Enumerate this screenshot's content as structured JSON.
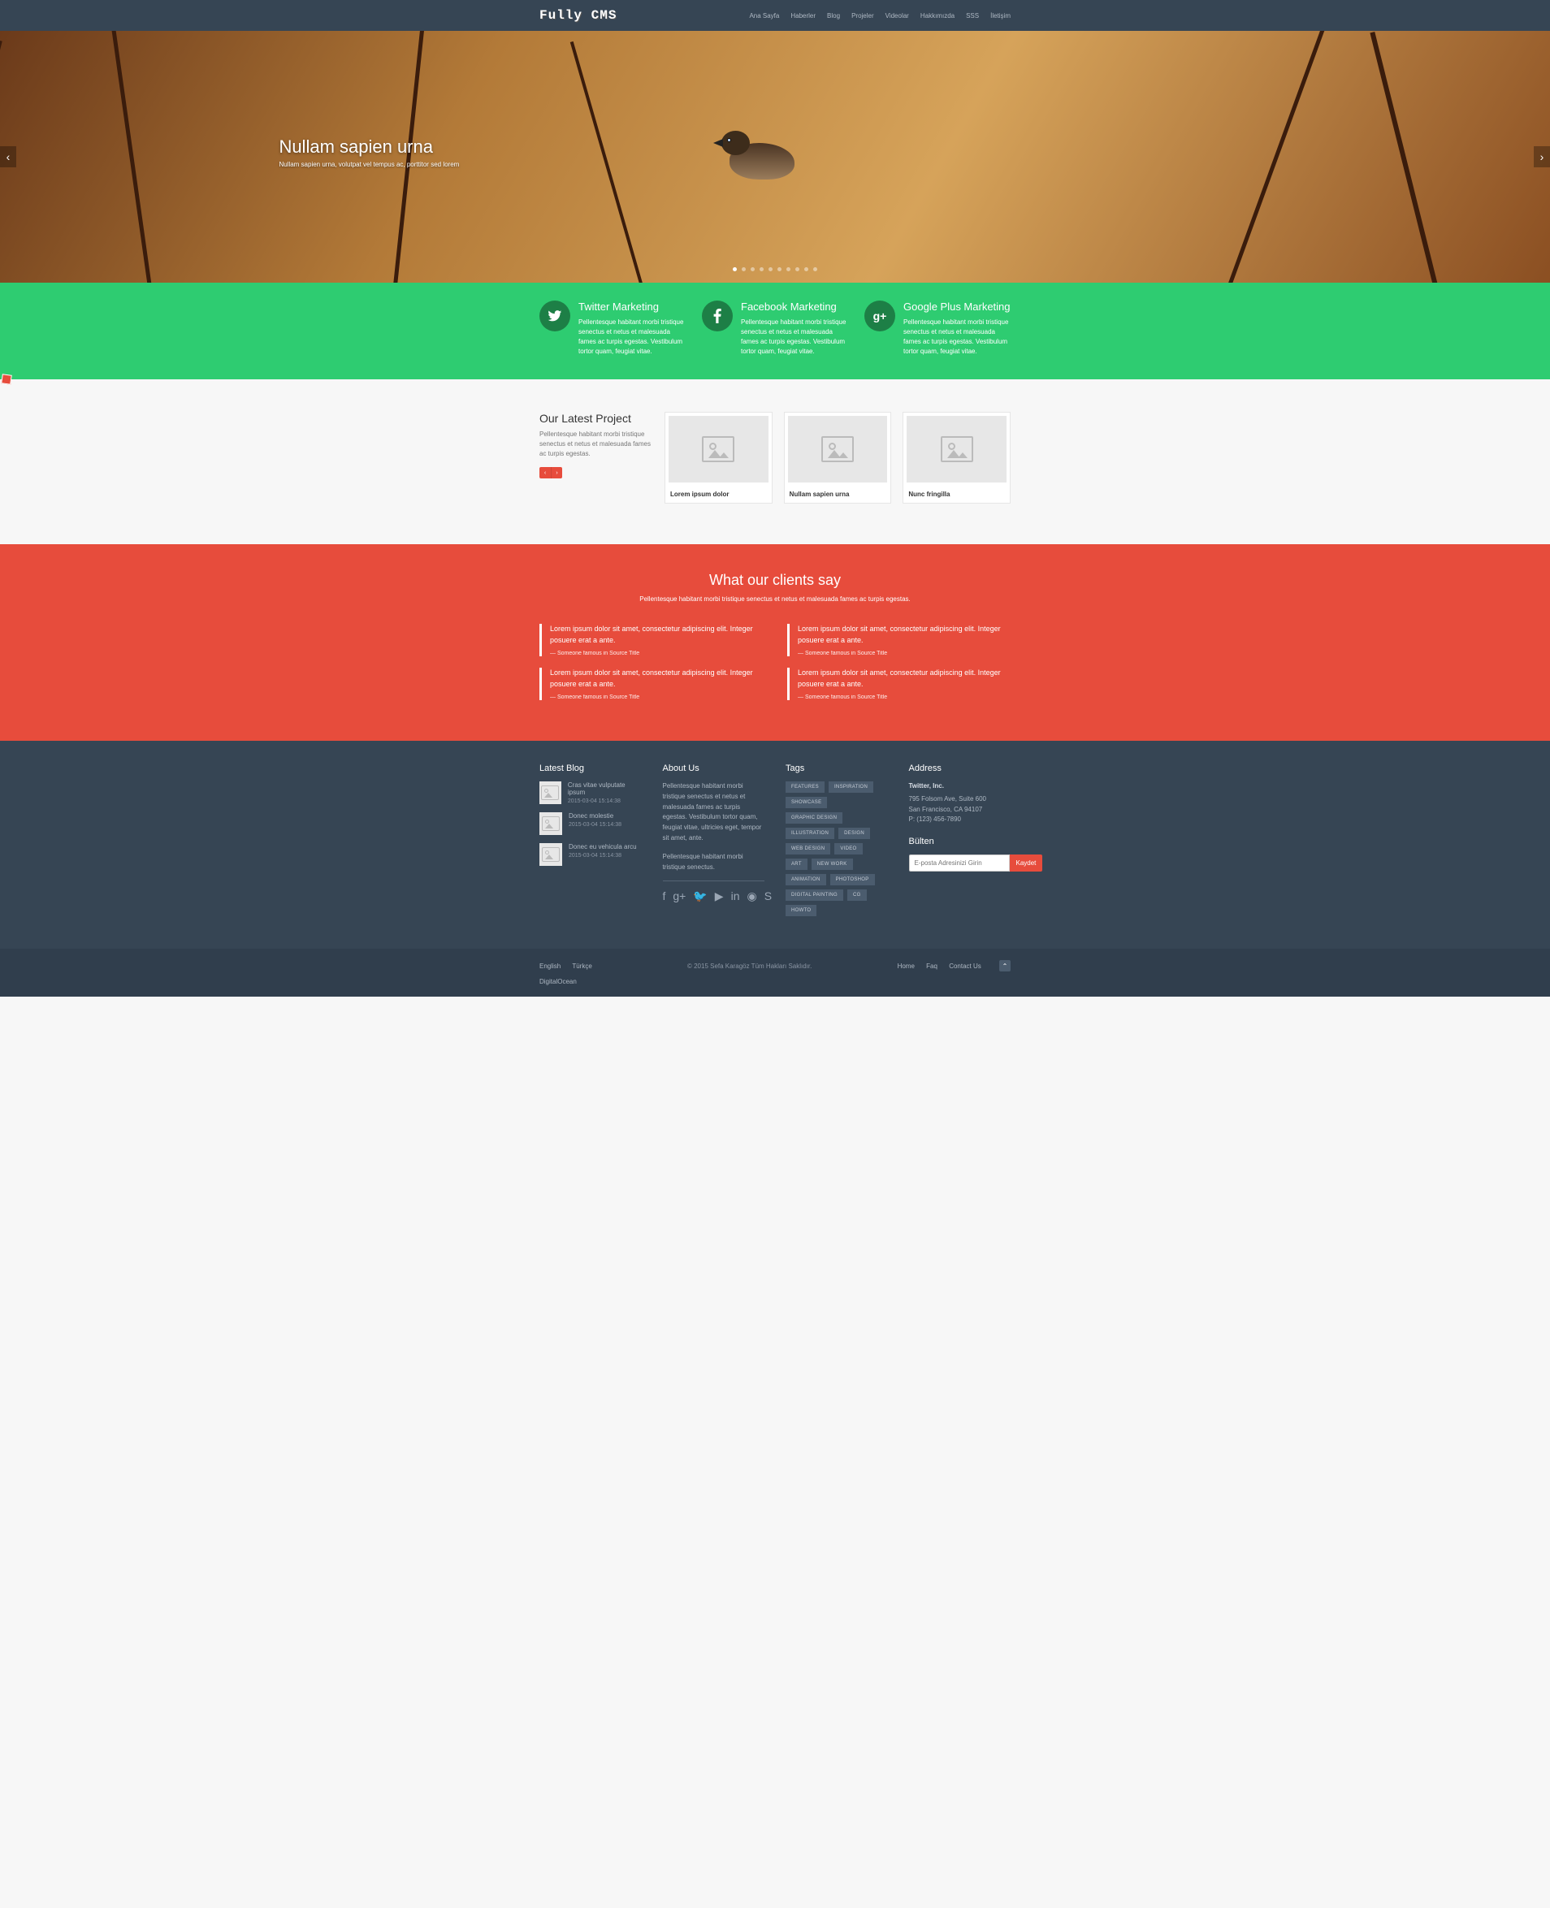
{
  "logo": "Fully CMS",
  "nav": [
    "Ana Sayfa",
    "Haberler",
    "Blog",
    "Projeler",
    "Videolar",
    "Hakkımızda",
    "SSS",
    "İletişim"
  ],
  "hero": {
    "title": "Nullam sapien urna",
    "subtitle": "Nullam sapien urna, volutpat vel tempus ac, porttitor sed lorem"
  },
  "services": [
    {
      "title": "Twitter Marketing",
      "desc": "Pellentesque habitant morbi tristique senectus et netus et malesuada fames ac turpis egestas. Vestibulum tortor quam, feugiat vitae."
    },
    {
      "title": "Facebook Marketing",
      "desc": "Pellentesque habitant morbi tristique senectus et netus et malesuada fames ac turpis egestas. Vestibulum tortor quam, feugiat vitae."
    },
    {
      "title": "Google Plus Marketing",
      "desc": "Pellentesque habitant morbi tristique senectus et netus et malesuada fames ac turpis egestas. Vestibulum tortor quam, feugiat vitae."
    }
  ],
  "projects": {
    "heading": "Our Latest Project",
    "desc": "Pellentesque habitant morbi tristique senectus et netus et malesuada fames ac turpis egestas.",
    "items": [
      "Lorem ipsum dolor",
      "Nullam sapien urna",
      "Nunc fringilla"
    ]
  },
  "testimonials": {
    "heading": "What our clients say",
    "sub": "Pellentesque habitant morbi tristique senectus et netus et malesuada fames ac turpis egestas.",
    "quote_text": "Lorem ipsum dolor sit amet, consectetur adipiscing elit. Integer posuere erat a ante.",
    "cite": "— Someone famous in Source Title"
  },
  "footer": {
    "latest_blog_heading": "Latest Blog",
    "blog": [
      {
        "title": "Cras vitae vulputate ipsum",
        "date": "2015-03-04 15:14:38"
      },
      {
        "title": "Donec molestie",
        "date": "2015-03-04 15:14:38"
      },
      {
        "title": "Donec eu vehicula arcu",
        "date": "2015-03-04 15:14:38"
      }
    ],
    "about_heading": "About Us",
    "about1": "Pellentesque habitant morbi tristique senectus et netus et malesuada fames ac turpis egestas. Vestibulum tortor quam, feugiat vitae, ultricies eget, tempor sit amet, ante.",
    "about2": "Pellentesque habitant morbi tristique senectus.",
    "tags_heading": "Tags",
    "tags": [
      "FEATURES",
      "INSPIRATION",
      "SHOWCASE",
      "GRAPHIC DESIGN",
      "ILLUSTRATION",
      "DESIGN",
      "WEB DESIGN",
      "VIDEO",
      "ART",
      "NEW WORK",
      "ANIMATION",
      "PHOTOSHOP",
      "DIGITAL PAINTING",
      "CG",
      "HOWTO"
    ],
    "address_heading": "Address",
    "addr_name": "Twitter, Inc.",
    "addr_l1": "795 Folsom Ave, Suite 600",
    "addr_l2": "San Francisco, CA 94107",
    "addr_l3": "P: (123) 456-7890",
    "newsletter_heading": "Bülten",
    "newsletter_placeholder": "E-posta Adresinizi Girin",
    "newsletter_btn": "Kaydet"
  },
  "bottom": {
    "langs": [
      "English",
      "Türkçe"
    ],
    "copyright": "© 2015 Sefa Karagöz Tüm Hakları Saklıdır.",
    "links": [
      "Home",
      "Faq",
      "Contact Us"
    ],
    "sponsor": "DigitalOcean"
  }
}
